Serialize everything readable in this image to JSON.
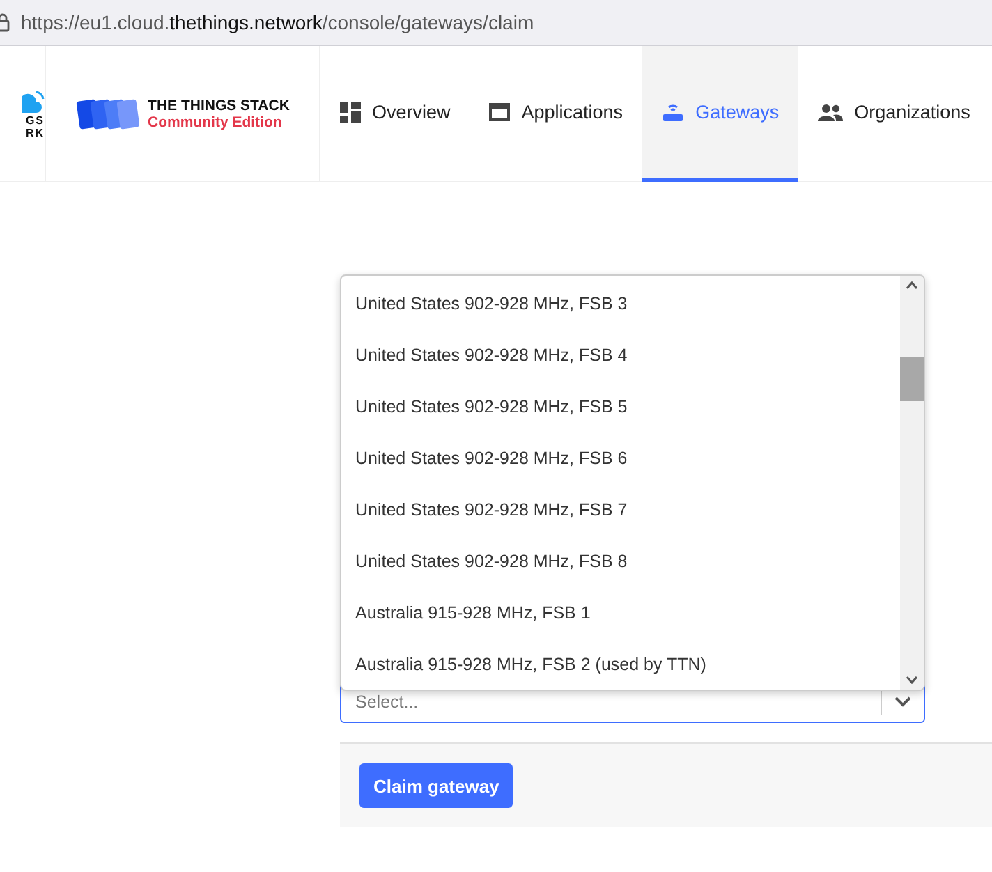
{
  "address_bar": {
    "url_prefix": "https://eu1.cloud.",
    "url_domain": "thethings.network",
    "url_path": "/console/gateways/claim"
  },
  "header": {
    "network_logo_lines": [
      "GS",
      "RK"
    ],
    "brand_title": "THE THINGS STACK",
    "brand_subtitle": "Community Edition",
    "tabs": [
      {
        "label": "Overview",
        "kind": "overview",
        "selected": false
      },
      {
        "label": "Applications",
        "kind": "applications",
        "selected": false
      },
      {
        "label": "Gateways",
        "kind": "gateways",
        "selected": true
      },
      {
        "label": "Organizations",
        "kind": "organizations",
        "selected": false
      }
    ]
  },
  "page": {
    "dropdown_options": [
      "United States 902-928 MHz, FSB 3",
      "United States 902-928 MHz, FSB 4",
      "United States 902-928 MHz, FSB 5",
      "United States 902-928 MHz, FSB 6",
      "United States 902-928 MHz, FSB 7",
      "United States 902-928 MHz, FSB 8",
      "Australia 915-928 MHz, FSB 1",
      "Australia 915-928 MHz, FSB 2 (used by TTN)"
    ],
    "select": {
      "placeholder": "Select..."
    },
    "submit_button": "Claim gateway"
  }
}
